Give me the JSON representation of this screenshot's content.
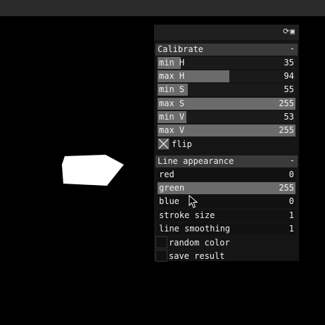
{
  "panel": {
    "calibrate": {
      "title": "Calibrate",
      "collapse": "-",
      "sliders": [
        {
          "label": "min H",
          "value": "35",
          "fill": 0.17
        },
        {
          "label": "max H",
          "value": "94",
          "fill": 0.52
        },
        {
          "label": "min S",
          "value": "55",
          "fill": 0.22
        },
        {
          "label": "max S",
          "value": "255",
          "fill": 1.0
        },
        {
          "label": "min V",
          "value": "53",
          "fill": 0.21
        },
        {
          "label": "max V",
          "value": "255",
          "fill": 1.0
        }
      ],
      "flip": {
        "label": "flip",
        "checked": true
      }
    },
    "line_appearance": {
      "title": "Line appearance",
      "collapse": "-",
      "sliders": [
        {
          "label": "red",
          "value": "0",
          "fill": 0
        },
        {
          "label": "green",
          "value": "255",
          "fill": 1.0
        },
        {
          "label": "blue",
          "value": "0",
          "fill": 0
        },
        {
          "label": "stroke size",
          "value": "1",
          "fill": 0
        },
        {
          "label": "line smoothing",
          "value": "1",
          "fill": 0
        }
      ]
    },
    "toggles": [
      {
        "label": "random color",
        "checked": false
      },
      {
        "label": "save result",
        "checked": false
      }
    ]
  }
}
